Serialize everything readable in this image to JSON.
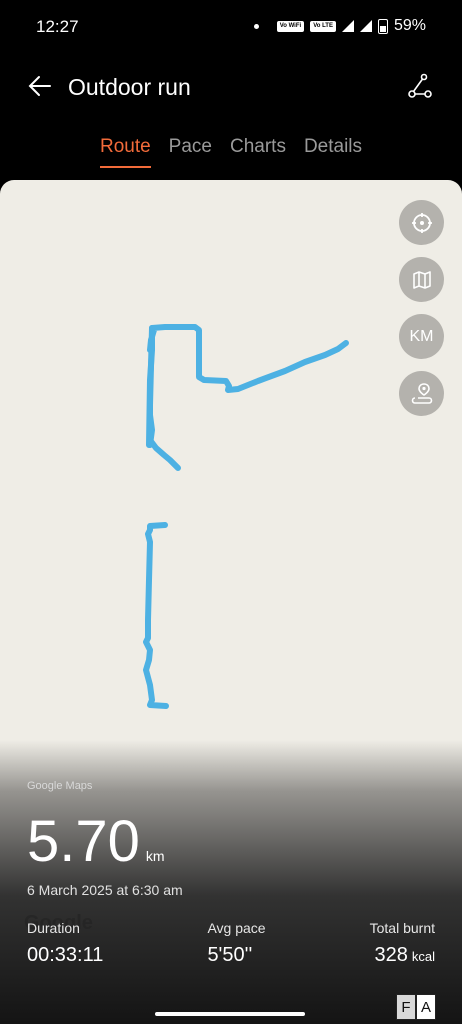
{
  "status_bar": {
    "time": "12:27",
    "chip1": "Vo WiFi",
    "chip2": "Vo LTE",
    "battery": "59%"
  },
  "header": {
    "title": "Outdoor run"
  },
  "tabs": [
    {
      "label": "Route",
      "active": true
    },
    {
      "label": "Pace",
      "active": false
    },
    {
      "label": "Charts",
      "active": false
    },
    {
      "label": "Details",
      "active": false
    }
  ],
  "map": {
    "attribution": "Google Maps",
    "google_logo": "Google",
    "route_color": "#4db1e3",
    "buttons": [
      "locate-icon",
      "map-type-icon",
      "KM",
      "route-pin-icon"
    ],
    "km_label": "KM"
  },
  "summary": {
    "distance": "5.70",
    "distance_unit": "km",
    "date": "6 March 2025 at 6:30 am",
    "duration_label": "Duration",
    "duration_value": "00:33:11",
    "pace_label": "Avg pace",
    "pace_value": "5'50''",
    "burnt_label": "Total burnt",
    "burnt_value": "328",
    "burnt_unit": "kcal"
  },
  "corner_badge": {
    "left": "F",
    "right": "A"
  }
}
